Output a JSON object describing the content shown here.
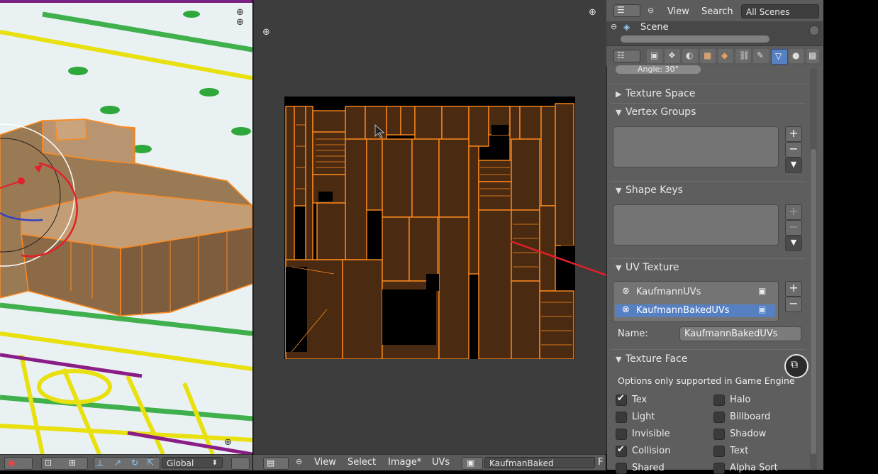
{
  "viewport3d": {
    "header": {
      "orientation_select": "Global"
    }
  },
  "uv_editor": {
    "header": {
      "menu_view": "View",
      "menu_select": "Select",
      "menu_image": "Image*",
      "menu_uvs": "UVs",
      "image_name": "KaufmanBaked",
      "extra": "F"
    }
  },
  "outliner": {
    "menu_view": "View",
    "menu_search": "Search",
    "scene_filter": "All Scenes",
    "scene_label": "Scene"
  },
  "properties": {
    "angle_field": "Angle: 30°",
    "panels": {
      "texture_space": "Texture Space",
      "vertex_groups": "Vertex Groups",
      "shape_keys": "Shape Keys",
      "uv_texture": "UV Texture",
      "texture_face": "Texture Face"
    },
    "uv_textures": [
      {
        "name": "KaufmannUVs"
      },
      {
        "name": "KaufmannBakedUVs"
      }
    ],
    "name_label": "Name:",
    "name_value": "KaufmannBakedUVs",
    "texture_face_note": "Options only supported in Game Engine",
    "texture_face_options": {
      "tex": "Tex",
      "halo": "Halo",
      "light": "Light",
      "billboard": "Billboard",
      "invisible": "Invisible",
      "shadow": "Shadow",
      "collision": "Collision",
      "text": "Text",
      "shared": "Shared",
      "alpha_sort": "Alpha Sort"
    }
  },
  "colors": {
    "uv_orange": "#ff8a1f",
    "selection_blue": "#5680c2",
    "annotation_red": "#e0202a"
  }
}
